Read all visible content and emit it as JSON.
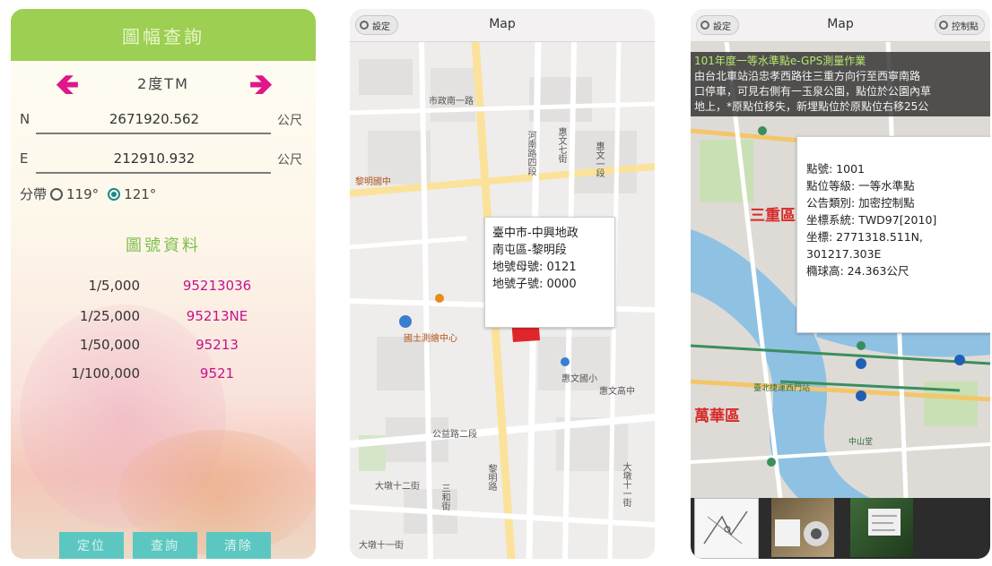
{
  "screen1": {
    "title": "圖幅查詢",
    "projection": "2度TM",
    "n_label": "N",
    "n_value": "2671920.562",
    "e_label": "E",
    "e_value": "212910.932",
    "unit": "公尺",
    "zone_label": "分帶",
    "zone_opt1": "119°",
    "zone_opt2": "121°",
    "zone_selected": "121°",
    "sheet_title": "圖號資料",
    "sheets": [
      {
        "scale": "1/5,000",
        "number": "95213036"
      },
      {
        "scale": "1/25,000",
        "number": "95213NE"
      },
      {
        "scale": "1/50,000",
        "number": "95213"
      },
      {
        "scale": "1/100,000",
        "number": "9521"
      }
    ],
    "btn_locate": "定位",
    "btn_query": "查詢",
    "btn_clear": "清除",
    "accent": "#9ccf52",
    "number_color": "#c6138a"
  },
  "screen2": {
    "settings": "設定",
    "title": "Map",
    "popup": {
      "line1": "臺中市-中興地政",
      "line2": "南屯區-黎明段",
      "line3": "地號母號: 0121",
      "line4": "地號子號: 0000"
    },
    "labels": {
      "road1": "市政南一路",
      "road2": "河南路四段",
      "road3": "惠文七街",
      "road4": "惠文一段",
      "road5": "公益路二段",
      "road6": "大墩十二街",
      "road7": "大墩十一街",
      "road8": "黎明路",
      "road9": "大墩十一街",
      "road10": "三和街",
      "poi1": "國土測繪中心",
      "poi2": "惠文國小",
      "poi3": "惠文高中",
      "poi4": "黎明國中"
    }
  },
  "screen3": {
    "settings": "設定",
    "title": "Map",
    "control_points": "控制點",
    "banner": {
      "heading": "101年度一等水準點e-GPS測量作業",
      "body1": "由台北車站沿忠孝西路往三重方向行至西寧南路",
      "body2": "口停車，可見右側有一玉泉公園，點位於公園內草",
      "body3": "地上，*原點位移失，新埋點位於原點位右移25公"
    },
    "popup": {
      "line1": "點號: 1001",
      "line2": "點位等級: 一等水準點",
      "line3": "公告類別: 加密控制點",
      "line4": "坐標系統: TWD97[2010]",
      "line5": "坐標: 2771318.511N,",
      "line6": "301217.303E",
      "line7": "橢球高: 24.363公尺"
    },
    "labels": {
      "district1": "三重區",
      "district2": "萬華區",
      "poi1": "臺北捷運西門站",
      "poi2": "中山堂"
    }
  }
}
